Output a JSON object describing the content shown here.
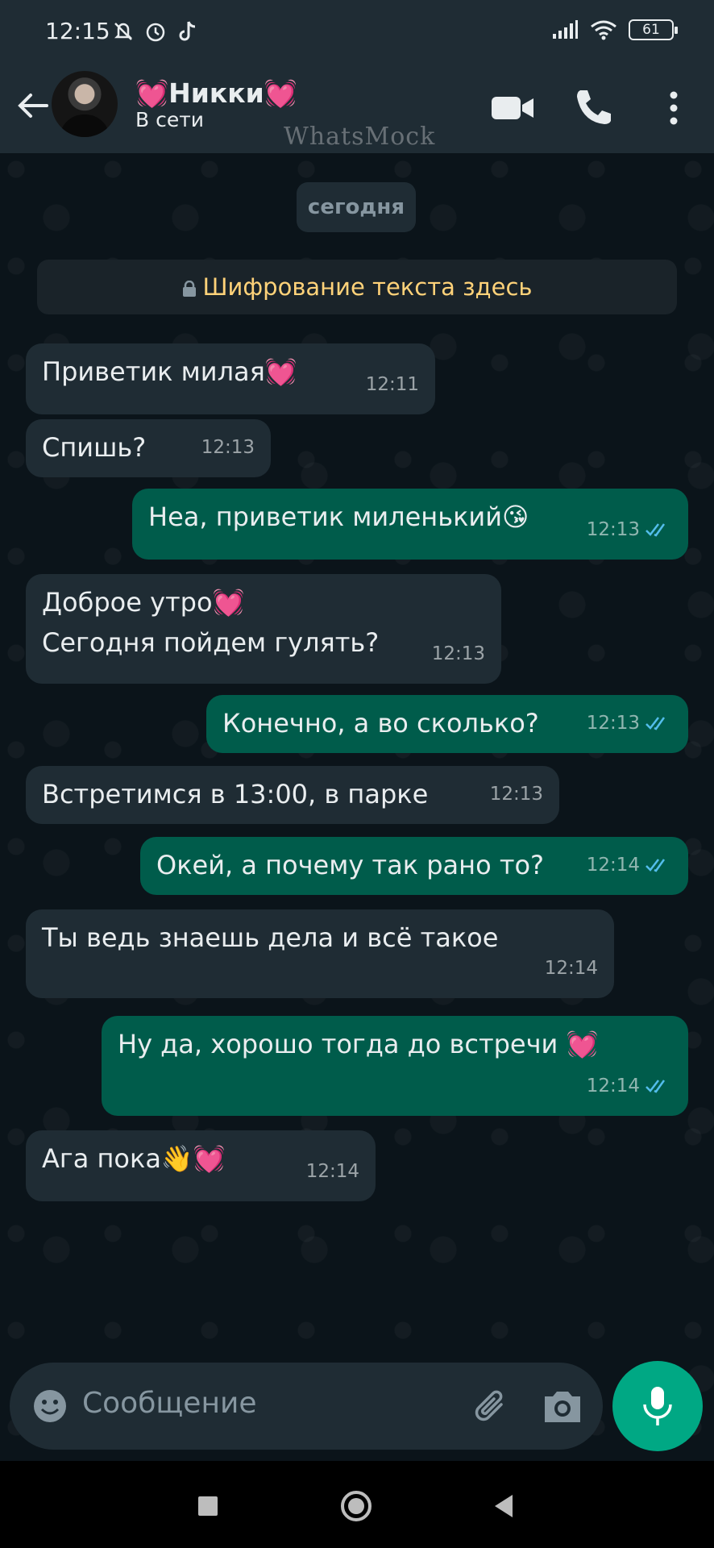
{
  "status_bar": {
    "time": "12:15",
    "battery": "61",
    "left_icons": [
      "mute-icon",
      "alarm-icon",
      "tiktok-icon"
    ],
    "right_icons": [
      "signal-icon",
      "wifi-icon",
      "battery-icon"
    ]
  },
  "header": {
    "contact_name": "💓Никки💓",
    "status": "В сети",
    "watermark": "WhatsMock",
    "icons": [
      "back-arrow-icon",
      "video-call-icon",
      "voice-call-icon",
      "more-vert-icon"
    ]
  },
  "chat": {
    "date_label": "сегодня",
    "encryption_note": "Шифрование текста здесь",
    "messages": [
      {
        "direction": "in",
        "text": "Приветик милая",
        "emoji": "💓",
        "time": "12:11"
      },
      {
        "direction": "in",
        "text": "Спишь?",
        "time": "12:13"
      },
      {
        "direction": "out",
        "text": "Неа, приветик миленький",
        "emoji": "😘",
        "time": "12:13",
        "read": true
      },
      {
        "direction": "in",
        "line1": "Доброе утро",
        "emoji": "💓",
        "line2": "Сегодня пойдем гулять?",
        "time": "12:13"
      },
      {
        "direction": "out",
        "text": "Конечно, а во сколько?",
        "time": "12:13",
        "read": true
      },
      {
        "direction": "in",
        "text": "Встретимся в 13:00, в парке",
        "time": "12:13"
      },
      {
        "direction": "out",
        "text": "Окей, а почему так рано то?",
        "time": "12:14",
        "read": true
      },
      {
        "direction": "in",
        "text": "Ты ведь знаешь дела и всё такое",
        "time": "12:14"
      },
      {
        "direction": "out",
        "text": "Ну да, хорошо тогда до встречи ",
        "emoji": "💓",
        "time": "12:14",
        "read": true
      },
      {
        "direction": "in",
        "text": "Ага пока",
        "emoji": "👋💓",
        "time": "12:14"
      }
    ]
  },
  "composer": {
    "placeholder": "Сообщение",
    "icons": [
      "emoji-icon",
      "attach-icon",
      "camera-icon",
      "mic-icon"
    ]
  },
  "nav": {
    "icons": [
      "recents-icon",
      "home-icon",
      "back-icon"
    ]
  },
  "colors": {
    "background": "#0b141a",
    "header": "#1f2c34",
    "incoming": "#1f2c34",
    "outgoing": "#005c4b",
    "accent": "#00a884",
    "read_ticks": "#53bdeb",
    "encryption_text": "#ffd279"
  }
}
